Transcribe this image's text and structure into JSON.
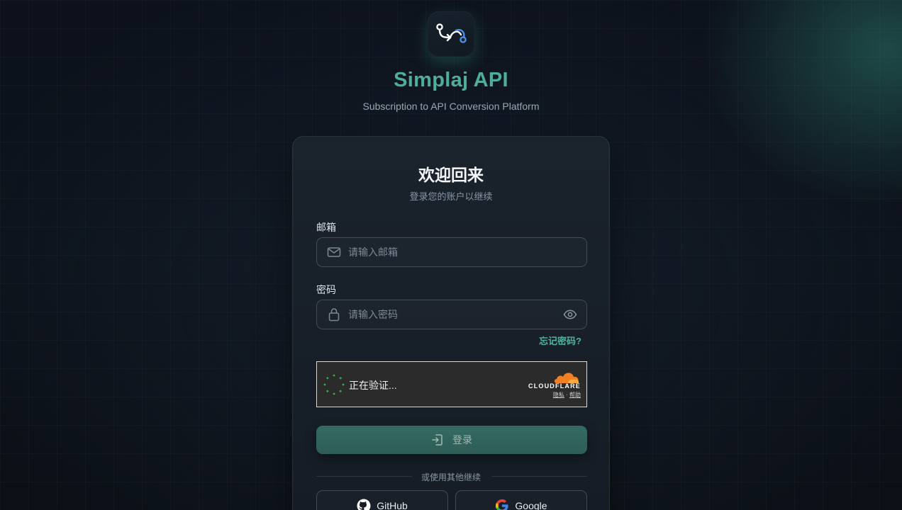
{
  "app": {
    "title": "Simplaj API",
    "subtitle": "Subscription to API Conversion Platform",
    "logo_icon": "route-icon"
  },
  "card": {
    "title": "欢迎回来",
    "subtitle": "登录您的账户以继续"
  },
  "email": {
    "label": "邮箱",
    "placeholder": "请输入邮箱",
    "value": "",
    "icon": "mail-icon"
  },
  "password": {
    "label": "密码",
    "placeholder": "请输入密码",
    "value": "",
    "icon": "lock-icon",
    "toggle_icon": "eye-icon"
  },
  "forgot_password": "忘记密码?",
  "captcha": {
    "status": "正在验证...",
    "brand": "CLOUDFLARE",
    "privacy": "隐私",
    "separator": "·",
    "help": "帮助"
  },
  "login_button": "登录",
  "divider": "或使用其他继续",
  "oauth": [
    {
      "label": "GitHub",
      "icon": "github-icon"
    },
    {
      "label": "Google",
      "icon": "google-icon"
    }
  ],
  "colors": {
    "accent": "#4fae9a",
    "background": "#0b0f17",
    "card": "#1a222c",
    "captcha_bg": "#2b2b2b",
    "cloudflare_orange": "#f38020"
  }
}
